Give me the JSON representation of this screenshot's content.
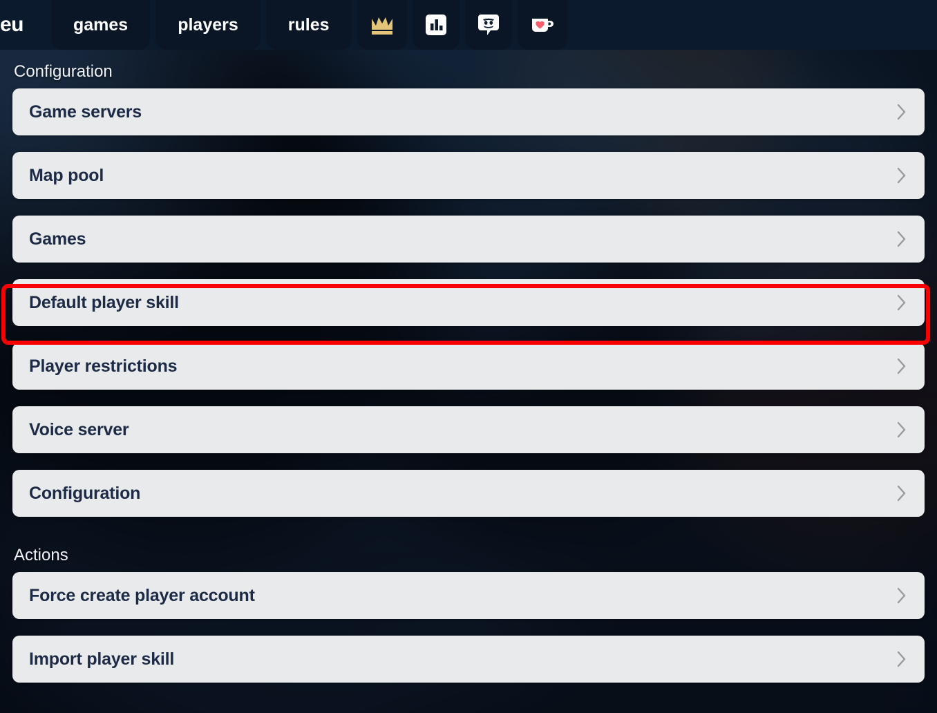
{
  "nav": {
    "brand": "eu",
    "tabs": [
      {
        "label": "games",
        "icon": null,
        "name": "nav-tab-games"
      },
      {
        "label": "players",
        "icon": null,
        "name": "nav-tab-players"
      },
      {
        "label": "rules",
        "icon": null,
        "name": "nav-tab-rules"
      },
      {
        "label": "",
        "icon": "crown-icon",
        "name": "nav-tab-leaderboard"
      },
      {
        "label": "",
        "icon": "bar-chart-icon",
        "name": "nav-tab-stats"
      },
      {
        "label": "",
        "icon": "discord-icon",
        "name": "nav-tab-discord"
      },
      {
        "label": "",
        "icon": "kofi-coffee-heart-icon",
        "name": "nav-tab-kofi"
      }
    ]
  },
  "sections": [
    {
      "title": "Configuration",
      "items": [
        {
          "label": "Game servers"
        },
        {
          "label": "Map pool"
        },
        {
          "label": "Games"
        },
        {
          "label": "Default player skill"
        },
        {
          "label": "Player restrictions"
        },
        {
          "label": "Voice server"
        },
        {
          "label": "Configuration"
        }
      ]
    },
    {
      "title": "Actions",
      "items": [
        {
          "label": "Force create player account"
        },
        {
          "label": "Import player skill"
        }
      ]
    }
  ],
  "highlight": {
    "target_label": "Default player skill",
    "color": "#fb0000"
  },
  "colors": {
    "header_bg": "#0c1a2e",
    "tab_bg": "#0a1625",
    "card_bg": "#e8eaeb",
    "card_text": "#1d2b46",
    "section_text": "#eef2f6",
    "chevron": "#9a9a9a",
    "crown_gold": "#e3c478",
    "kofi_heart": "#f4606a",
    "annotation_red": "#fb0000"
  }
}
